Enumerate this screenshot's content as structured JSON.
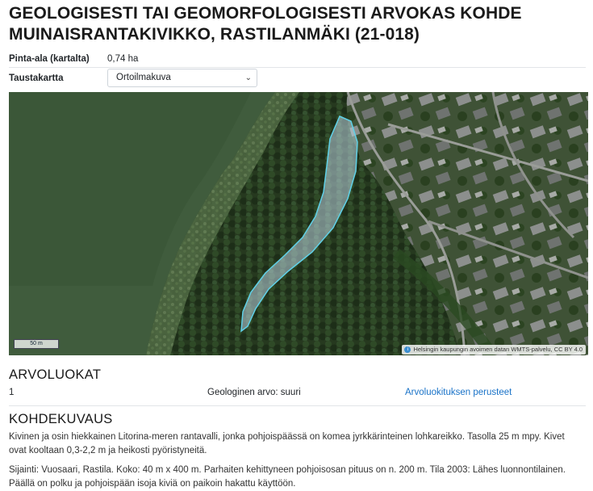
{
  "header": {
    "title": "GEOLOGISESTI TAI GEOMORFOLOGISESTI ARVOKAS KOHDE MUINAISRANTAKIVIKKO, RASTILANMÄKI (21-018)"
  },
  "properties": {
    "area_label": "Pinta-ala (kartalta)",
    "area_value": "0,74 ha",
    "basemap_label": "Taustakartta",
    "basemap_selected": "Ortoilmakuva"
  },
  "map": {
    "scale_label": "50 m",
    "attribution": "Helsingin kaupungin avoimen datan WMTS-palvelu, CC BY 4.0",
    "info_icon": "info-icon",
    "polygon_color": "#b9d3e0"
  },
  "arvoluokat": {
    "heading": "ARVOLUOKAT",
    "class_number": "1",
    "class_text": "Geologinen arvo: suuri",
    "link_text": "Arvoluokituksen perusteet"
  },
  "kohdekuvaus": {
    "heading": "KOHDEKUVAUS",
    "paragraph1": "Kivinen ja osin hiekkainen Litorina-meren rantavalli, jonka pohjoispäässä on komea jyrkkärinteinen lohkareikko. Tasolla 25 m mpy. Kivet ovat kooltaan 0,3-2,2 m ja heikosti pyöristyneitä.",
    "paragraph2": "Sijainti: Vuosaari, Rastila. Koko: 40 m x 400 m. Parhaiten kehittyneen pohjoisosan pituus on n. 200 m. Tila 2003: Lähes luonnontilainen. Päällä on polku ja pohjoispään isoja kiviä on paikoin hakattu käyttöön."
  },
  "colors": {
    "link": "#1a73c8",
    "water": "#3f5a3c",
    "forest": "#24361e"
  }
}
